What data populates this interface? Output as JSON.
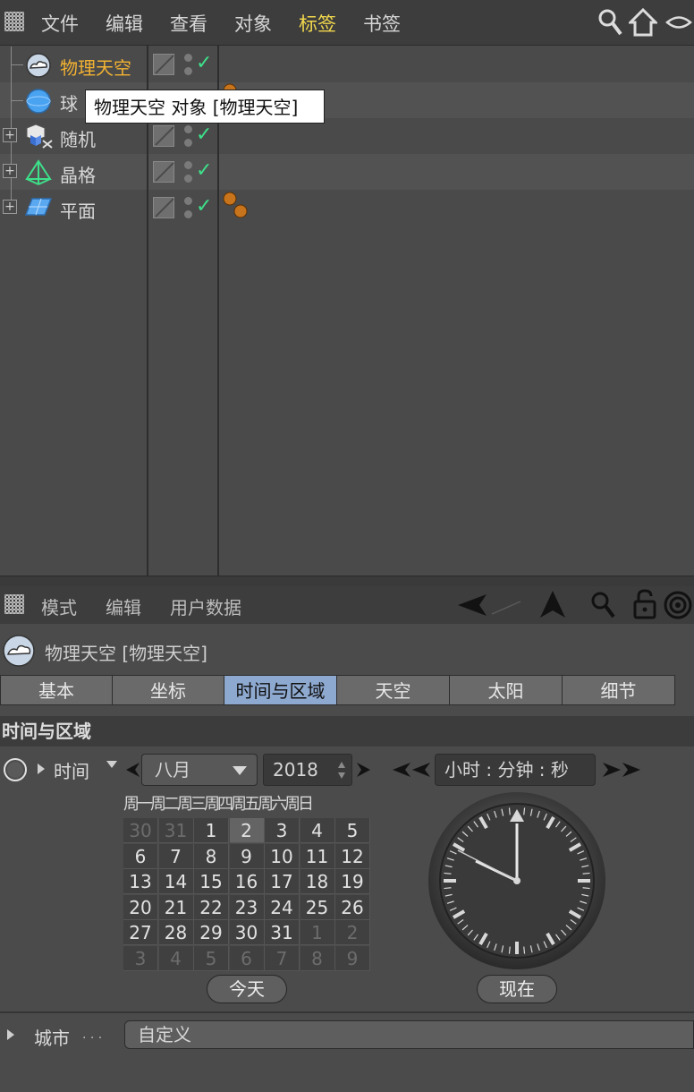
{
  "menubar": {
    "items": [
      "文件",
      "编辑",
      "查看",
      "对象",
      "标签",
      "书签"
    ],
    "active_index": 4
  },
  "tree": {
    "rows": [
      {
        "name": "物理天空",
        "icon": "physical-sky-icon",
        "selected": true,
        "tags": 0
      },
      {
        "name": "球体",
        "icon": "sphere-icon",
        "selected": false,
        "tags": 1
      },
      {
        "name": "随机",
        "icon": "random-effector-icon",
        "selected": false,
        "tags": 0
      },
      {
        "name": "晶格",
        "icon": "atom-array-icon",
        "selected": false,
        "tags": 0
      },
      {
        "name": "平面",
        "icon": "plane-icon",
        "selected": false,
        "tags": 1
      }
    ],
    "visible_second_label": "球",
    "tooltip": "物理天空 对象 [物理天空]",
    "check_glyph": "✓"
  },
  "attributes": {
    "menu": [
      "模式",
      "编辑",
      "用户数据"
    ],
    "object_title": "物理天空 [物理天空]",
    "tabs": [
      "基本",
      "坐标",
      "时间与区域",
      "天空",
      "太阳",
      "细节"
    ],
    "active_tab": 2,
    "section_title": "时间与区域",
    "time_label": "时间",
    "month_value": "八月",
    "year_value": "2018",
    "time_format": "小时 : 分钟 : 秒",
    "weekday_header": "周一周二周三周四周五周六周日",
    "calendar_rows": [
      [
        "30",
        "31",
        "1",
        "2",
        "3",
        "4",
        "5"
      ],
      [
        "6",
        "7",
        "8",
        "9",
        "10",
        "11",
        "12"
      ],
      [
        "13",
        "14",
        "15",
        "16",
        "17",
        "18",
        "19"
      ],
      [
        "20",
        "21",
        "22",
        "23",
        "24",
        "25",
        "26"
      ],
      [
        "27",
        "28",
        "29",
        "30",
        "31",
        "1",
        "2"
      ],
      [
        "3",
        "4",
        "5",
        "6",
        "7",
        "8",
        "9"
      ]
    ],
    "selected_day": "2",
    "today_button": "今天",
    "now_button": "现在",
    "city_label": "城市",
    "city_dots": ". . .",
    "city_value": "自定义"
  },
  "colors": {
    "accent_active_menu": "#f2d84d",
    "selected_object": "#f2b232",
    "active_tab": "#8ea9cf",
    "check": "#3ee08a"
  }
}
